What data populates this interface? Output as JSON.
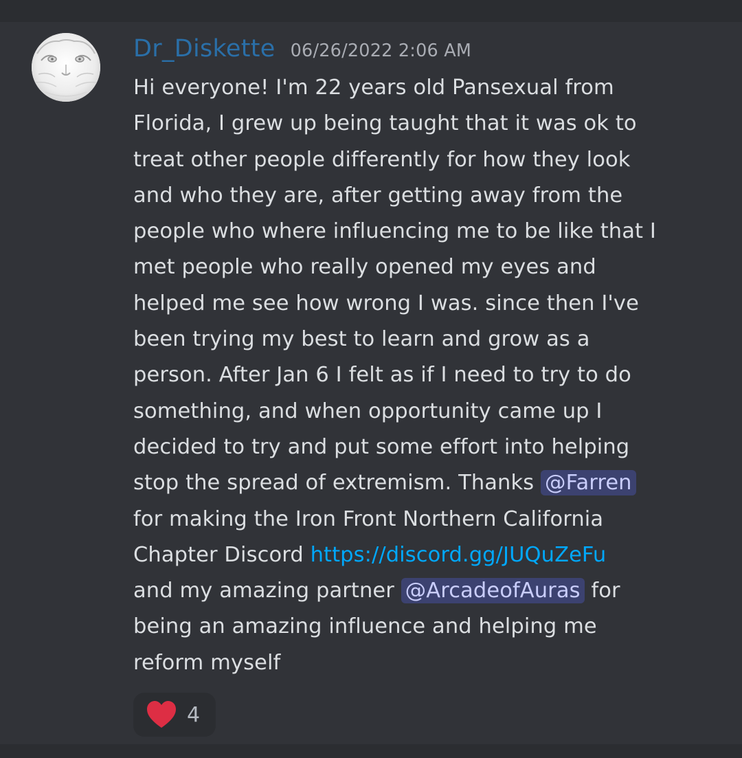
{
  "message": {
    "author": {
      "username": "Dr_Diskette",
      "avatar_icon": "white-tiger-avatar-icon"
    },
    "timestamp": "06/26/2022 2:06 AM",
    "lines": [
      {
        "text": "Hi everyone! I'm 22 years old Pansexual from"
      },
      {
        "text": "Florida, I grew up being taught that it was ok to"
      },
      {
        "text": "treat other people differently for how they look"
      },
      {
        "text": "and who they are, after getting away from the"
      },
      {
        "text": "people who where influencing me to be like that I"
      },
      {
        "text": "met people who really opened my eyes and"
      },
      {
        "text": "helped me see how wrong I was. since then I've"
      },
      {
        "text": "been trying my best to learn and grow as a"
      },
      {
        "text": "person. After Jan 6 I felt as if I need to try to do"
      },
      {
        "text": "something, and when opportunity came up I"
      },
      {
        "text": "decided to try and put some effort into helping"
      },
      {
        "before": "stop the spread of extremism. Thanks ",
        "mention": "@Farren"
      },
      {
        "text": "for making the Iron Front Northern California"
      },
      {
        "before": "Chapter Discord ",
        "link": "https://discord.gg/JUQuZeFu"
      },
      {
        "before": "and my amazing partner ",
        "mention": "@ArcadeofAuras",
        "after": " for"
      },
      {
        "text": "being an amazing influence and helping me"
      },
      {
        "text": "reform myself"
      }
    ],
    "reaction": {
      "emoji_icon": "red-heart-icon",
      "count": "4"
    }
  },
  "colors": {
    "background": "#313338",
    "username": "#2a6fa8",
    "timestamp": "#a9acb3",
    "text": "#dbdee1",
    "mention_bg": "#3c4270",
    "mention_text": "#c9cdfb",
    "link": "#00a8fc",
    "reaction_bg": "#2b2d31",
    "heart": "#dd2e44"
  }
}
